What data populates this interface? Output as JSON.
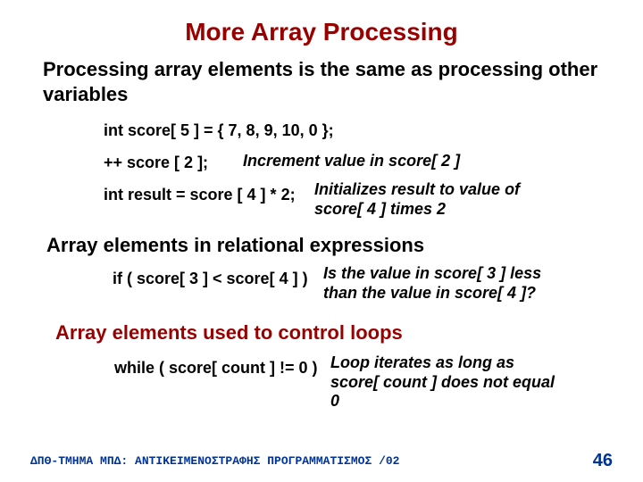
{
  "title": "More Array Processing",
  "sub1": "Processing array elements is the same as processing other variables",
  "decl": "int score[ 5 ] = { 7, 8, 9, 10, 0 };",
  "inc_code": "++ score [ 2 ];",
  "inc_note": "Increment value in score[ 2 ]",
  "res_code": "int result = score [ 4 ] * 2;",
  "res_note": "Initializes result to value of score[ 4 ] times 2",
  "sub2": "Array elements in relational expressions",
  "if_code": "if ( score[ 3 ] < score[ 4 ] )",
  "if_note": "Is the value in score[ 3 ] less than the value in score[ 4 ]?",
  "sub3": "Array elements used to control loops",
  "while_code": "while ( score[ count ] != 0 )",
  "while_note": "Loop iterates as long as score[ count ] does not equal 0",
  "footer": "ΔΠΘ-ΤΜΗΜΑ ΜΠΔ: ΑΝΤΙΚΕΙΜΕΝΟΣΤΡΑΦΗΣ ΠΡΟΓΡΑΜΜΑΤΙΣΜΟΣ /02",
  "page": "46"
}
